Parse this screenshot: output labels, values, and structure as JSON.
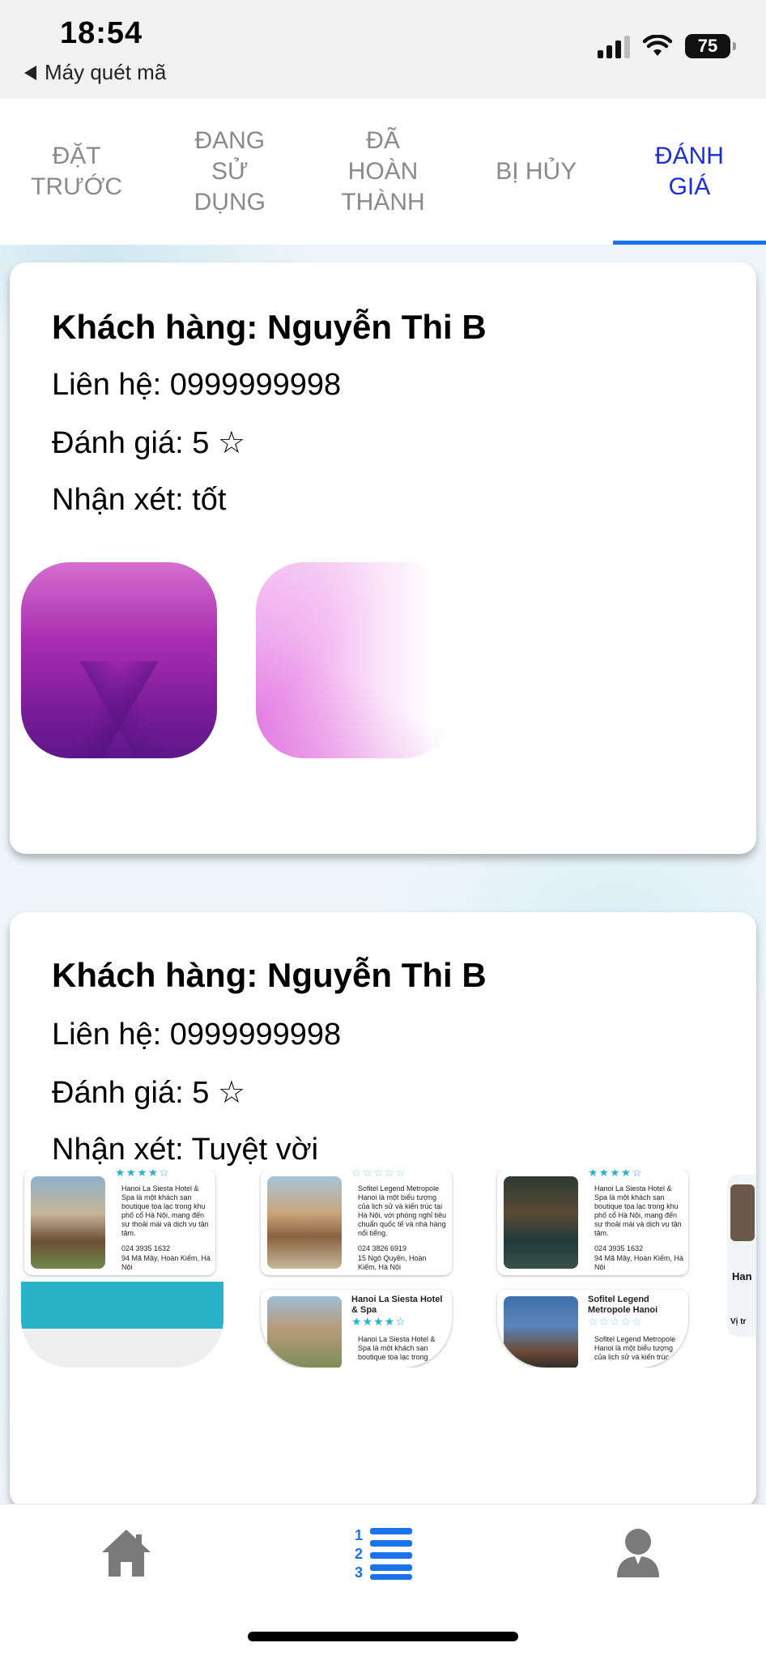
{
  "status_bar": {
    "time": "18:54",
    "back_label": "Máy quét mã",
    "battery": "75"
  },
  "tabs": [
    {
      "label": "ĐẶT\nTRƯỚC",
      "active": false
    },
    {
      "label": "ĐANG\nSỬ\nDỤNG",
      "active": false
    },
    {
      "label": "ĐÃ\nHOÀN\nTHÀNH",
      "active": false
    },
    {
      "label": "BỊ HỦY",
      "active": false
    },
    {
      "label": "ĐÁNH\nGIÁ",
      "active": true
    }
  ],
  "reviews": [
    {
      "customer": "Khách hàng: Nguyễn Thi B",
      "contact": "Liên hệ: 0999999998",
      "rating": "Đánh giá: 5 ☆",
      "comment": "Nhận xét: tốt"
    },
    {
      "customer": "Khách hàng: Nguyễn Thi B",
      "contact": "Liên hệ: 0999999998",
      "rating": "Đánh giá: 5 ☆",
      "comment": "Nhận xét: Tuyệt vời"
    }
  ],
  "thumbnails": {
    "t1": {
      "desc": "Hanoi La Siesta Hotel & Spa là một khách sạn boutique tọa lạc trong khu phố cổ Hà Nội, mang đến sự thoải mái và dịch vụ tận tâm.",
      "phone": "024 3935 1632",
      "address": "94 Mã Mây, Hoàn Kiếm, Hà Nội"
    },
    "t2": {
      "desc": "Sofitel Legend Metropole Hanoi là một biểu tượng của lịch sử và kiến trúc tại Hà Nội, với phòng nghỉ tiêu chuẩn quốc tế và nhà hàng nổi tiếng.",
      "phone": "024 3826 6919",
      "address": "15 Ngô Quyền, Hoàn Kiếm, Hà Nội",
      "card2_title": "Hanoi La Siesta Hotel & Spa",
      "card2_desc": "Hanoi La Siesta Hotel & Spa là một khách sạn boutique tọa lạc trong"
    },
    "t3": {
      "desc": "Hanoi La Siesta Hotel & Spa là một khách sạn boutique tọa lạc trong khu phố cổ Hà Nội, mang đến sự thoải mái và dịch vụ tận tâm.",
      "phone": "024 3935 1632",
      "address": "94 Mã Mây, Hoàn Kiếm, Hà Nội",
      "card2_title": "Sofitel Legend Metropole Hanoi",
      "card2_desc": "Sofitel Legend Metropole Hanoi là một biểu tượng của lịch sử và kiến trúc"
    },
    "t4": {
      "title_fragment": "Han",
      "label_fragment": "Vị tr"
    }
  },
  "colors": {
    "active_tab": "#1a2fd6",
    "active_indicator": "#1a73e8",
    "nav_active": "#1a73e8",
    "nav_inactive": "#7a7a7a",
    "star_teal": "#2ab3c8"
  },
  "bottom_nav": {
    "items": [
      "home-icon",
      "numbered-list-icon",
      "user-icon"
    ],
    "active": "numbered-list-icon",
    "list_numbers": [
      "1",
      "2",
      "3"
    ]
  }
}
